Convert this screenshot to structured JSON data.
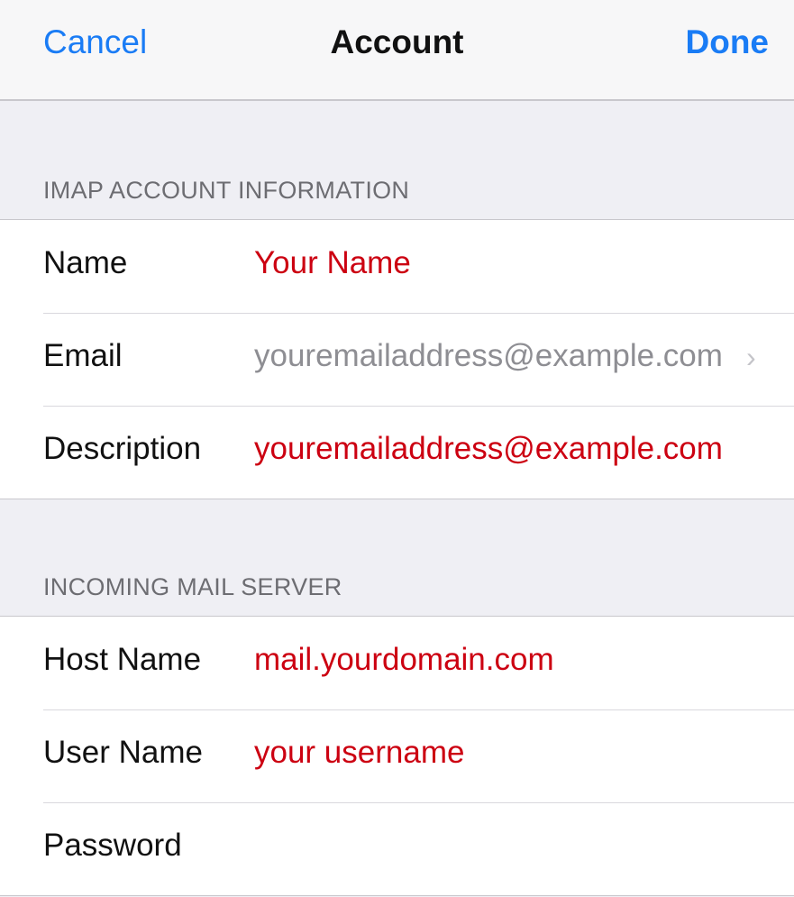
{
  "navbar": {
    "cancel_label": "Cancel",
    "title": "Account",
    "done_label": "Done"
  },
  "sections": {
    "imap": {
      "header": "IMAP ACCOUNT INFORMATION",
      "rows": {
        "name": {
          "label": "Name",
          "value": "Your Name"
        },
        "email": {
          "label": "Email",
          "value": "youremailaddress@example.com"
        },
        "description": {
          "label": "Description",
          "value": "youremailaddress@example.com"
        }
      }
    },
    "incoming": {
      "header": "INCOMING MAIL SERVER",
      "rows": {
        "host_name": {
          "label": "Host Name",
          "value": "mail.yourdomain.com"
        },
        "user_name": {
          "label": "User Name",
          "value": "your username"
        },
        "password": {
          "label": "Password",
          "value": ""
        }
      }
    }
  },
  "icons": {
    "email_disclosure": "chevron-right-icon"
  },
  "colors": {
    "accent": "#1a7cf5",
    "value_highlight": "#cc0011",
    "value_gray": "#8e8e93",
    "background": "#efeff4"
  }
}
